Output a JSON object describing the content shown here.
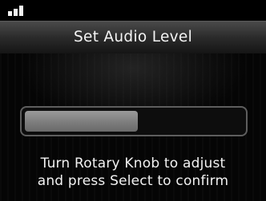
{
  "status_bar": {
    "signal_icon": "signal-strength-icon",
    "signal_bars": 3
  },
  "header": {
    "title": "Set Audio Level"
  },
  "audio_level": {
    "fraction": 0.52
  },
  "instructions": {
    "line1": "Turn Rotary Knob to adjust",
    "line2": "and press Select to confirm"
  },
  "colors": {
    "background": "#000000",
    "title_bar": "#2c2c2c",
    "level_fill": "#7d7d7d",
    "text": "#f2f2f2"
  }
}
